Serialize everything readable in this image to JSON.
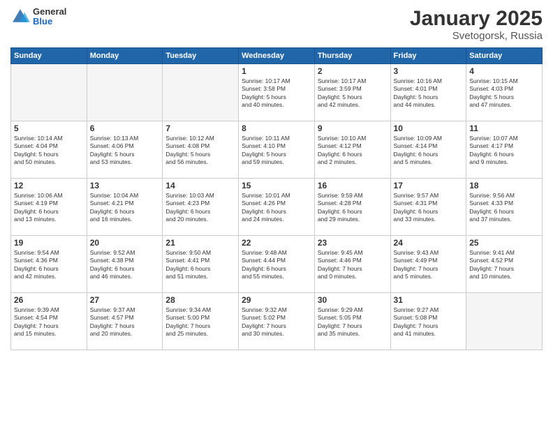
{
  "logo": {
    "general": "General",
    "blue": "Blue"
  },
  "title": "January 2025",
  "subtitle": "Svetogorsk, Russia",
  "weekdays": [
    "Sunday",
    "Monday",
    "Tuesday",
    "Wednesday",
    "Thursday",
    "Friday",
    "Saturday"
  ],
  "weeks": [
    [
      {
        "day": "",
        "info": ""
      },
      {
        "day": "",
        "info": ""
      },
      {
        "day": "",
        "info": ""
      },
      {
        "day": "1",
        "info": "Sunrise: 10:17 AM\nSunset: 3:58 PM\nDaylight: 5 hours\nand 40 minutes."
      },
      {
        "day": "2",
        "info": "Sunrise: 10:17 AM\nSunset: 3:59 PM\nDaylight: 5 hours\nand 42 minutes."
      },
      {
        "day": "3",
        "info": "Sunrise: 10:16 AM\nSunset: 4:01 PM\nDaylight: 5 hours\nand 44 minutes."
      },
      {
        "day": "4",
        "info": "Sunrise: 10:15 AM\nSunset: 4:03 PM\nDaylight: 5 hours\nand 47 minutes."
      }
    ],
    [
      {
        "day": "5",
        "info": "Sunrise: 10:14 AM\nSunset: 4:04 PM\nDaylight: 5 hours\nand 50 minutes."
      },
      {
        "day": "6",
        "info": "Sunrise: 10:13 AM\nSunset: 4:06 PM\nDaylight: 5 hours\nand 53 minutes."
      },
      {
        "day": "7",
        "info": "Sunrise: 10:12 AM\nSunset: 4:08 PM\nDaylight: 5 hours\nand 56 minutes."
      },
      {
        "day": "8",
        "info": "Sunrise: 10:11 AM\nSunset: 4:10 PM\nDaylight: 5 hours\nand 59 minutes."
      },
      {
        "day": "9",
        "info": "Sunrise: 10:10 AM\nSunset: 4:12 PM\nDaylight: 6 hours\nand 2 minutes."
      },
      {
        "day": "10",
        "info": "Sunrise: 10:09 AM\nSunset: 4:14 PM\nDaylight: 6 hours\nand 5 minutes."
      },
      {
        "day": "11",
        "info": "Sunrise: 10:07 AM\nSunset: 4:17 PM\nDaylight: 6 hours\nand 9 minutes."
      }
    ],
    [
      {
        "day": "12",
        "info": "Sunrise: 10:06 AM\nSunset: 4:19 PM\nDaylight: 6 hours\nand 13 minutes."
      },
      {
        "day": "13",
        "info": "Sunrise: 10:04 AM\nSunset: 4:21 PM\nDaylight: 6 hours\nand 16 minutes."
      },
      {
        "day": "14",
        "info": "Sunrise: 10:03 AM\nSunset: 4:23 PM\nDaylight: 6 hours\nand 20 minutes."
      },
      {
        "day": "15",
        "info": "Sunrise: 10:01 AM\nSunset: 4:26 PM\nDaylight: 6 hours\nand 24 minutes."
      },
      {
        "day": "16",
        "info": "Sunrise: 9:59 AM\nSunset: 4:28 PM\nDaylight: 6 hours\nand 29 minutes."
      },
      {
        "day": "17",
        "info": "Sunrise: 9:57 AM\nSunset: 4:31 PM\nDaylight: 6 hours\nand 33 minutes."
      },
      {
        "day": "18",
        "info": "Sunrise: 9:56 AM\nSunset: 4:33 PM\nDaylight: 6 hours\nand 37 minutes."
      }
    ],
    [
      {
        "day": "19",
        "info": "Sunrise: 9:54 AM\nSunset: 4:36 PM\nDaylight: 6 hours\nand 42 minutes."
      },
      {
        "day": "20",
        "info": "Sunrise: 9:52 AM\nSunset: 4:38 PM\nDaylight: 6 hours\nand 46 minutes."
      },
      {
        "day": "21",
        "info": "Sunrise: 9:50 AM\nSunset: 4:41 PM\nDaylight: 6 hours\nand 51 minutes."
      },
      {
        "day": "22",
        "info": "Sunrise: 9:48 AM\nSunset: 4:44 PM\nDaylight: 6 hours\nand 55 minutes."
      },
      {
        "day": "23",
        "info": "Sunrise: 9:45 AM\nSunset: 4:46 PM\nDaylight: 7 hours\nand 0 minutes."
      },
      {
        "day": "24",
        "info": "Sunrise: 9:43 AM\nSunset: 4:49 PM\nDaylight: 7 hours\nand 5 minutes."
      },
      {
        "day": "25",
        "info": "Sunrise: 9:41 AM\nSunset: 4:52 PM\nDaylight: 7 hours\nand 10 minutes."
      }
    ],
    [
      {
        "day": "26",
        "info": "Sunrise: 9:39 AM\nSunset: 4:54 PM\nDaylight: 7 hours\nand 15 minutes."
      },
      {
        "day": "27",
        "info": "Sunrise: 9:37 AM\nSunset: 4:57 PM\nDaylight: 7 hours\nand 20 minutes."
      },
      {
        "day": "28",
        "info": "Sunrise: 9:34 AM\nSunset: 5:00 PM\nDaylight: 7 hours\nand 25 minutes."
      },
      {
        "day": "29",
        "info": "Sunrise: 9:32 AM\nSunset: 5:02 PM\nDaylight: 7 hours\nand 30 minutes."
      },
      {
        "day": "30",
        "info": "Sunrise: 9:29 AM\nSunset: 5:05 PM\nDaylight: 7 hours\nand 35 minutes."
      },
      {
        "day": "31",
        "info": "Sunrise: 9:27 AM\nSunset: 5:08 PM\nDaylight: 7 hours\nand 41 minutes."
      },
      {
        "day": "",
        "info": ""
      }
    ]
  ]
}
